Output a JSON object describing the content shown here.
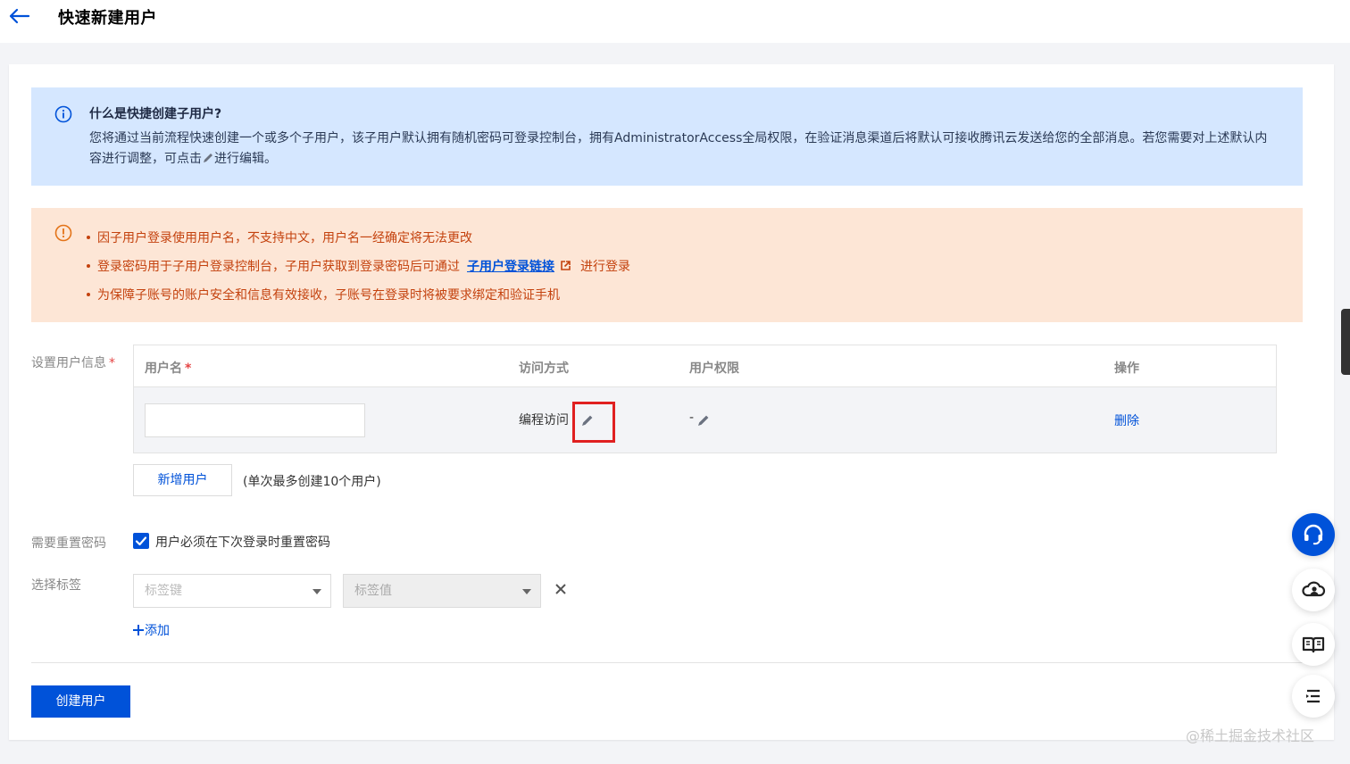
{
  "header": {
    "title": "快速新建用户"
  },
  "info": {
    "title": "什么是快捷创建子用户?",
    "body_part1": "您将通过当前流程快速创建一个或多个子用户，该子用户默认拥有随机密码可登录控制台，拥有AdministratorAccess全局权限，在验证消息渠道后将默认可接收腾讯云发送给您的全部消息。若您需要对上述默认内容进行调整，可点击",
    "body_part2": "进行编辑。"
  },
  "warnings": {
    "item1": "因子用户登录使用用户名，不支持中文，用户名一经确定将无法更改",
    "item2_before": "登录密码用于子用户登录控制台，子用户获取到登录密码后可通过",
    "item2_link": "子用户登录链接",
    "item2_after": "进行登录",
    "item3": "为保障子账号的账户安全和信息有效接收，子账号在登录时将被要求绑定和验证手机"
  },
  "form": {
    "user_info_label": "设置用户信息",
    "required_mark": "*",
    "table": {
      "headers": {
        "username": "用户名",
        "access": "访问方式",
        "permission": "用户权限",
        "action": "操作"
      },
      "row": {
        "username_value": "",
        "access": "编程访问",
        "permission": "-",
        "delete": "删除"
      }
    },
    "add_user_button": "新增用户",
    "limit_note": "(单次最多创建10个用户)",
    "reset_password_label": "需要重置密码",
    "reset_password_checkbox": "用户必须在下次登录时重置密码",
    "reset_password_checked": true,
    "tag_label": "选择标签",
    "tag_key_placeholder": "标签键",
    "tag_value_placeholder": "标签值",
    "add_tag": "添加",
    "create_button": "创建用户"
  },
  "watermark": "@稀土掘金技术社区",
  "colors": {
    "primary": "#0052d9",
    "info_bg": "#d5e7ff",
    "warn_bg": "#fde6d6",
    "warn_text": "#c4420e",
    "highlight": "#e02020"
  },
  "icons": [
    "back-arrow-icon",
    "info-icon",
    "pencil-icon",
    "warning-icon",
    "external-link-icon",
    "check-icon",
    "chevron-down-icon",
    "close-icon",
    "plus-icon",
    "headset-icon",
    "cloud-user-icon",
    "book-icon",
    "menu-list-icon"
  ]
}
